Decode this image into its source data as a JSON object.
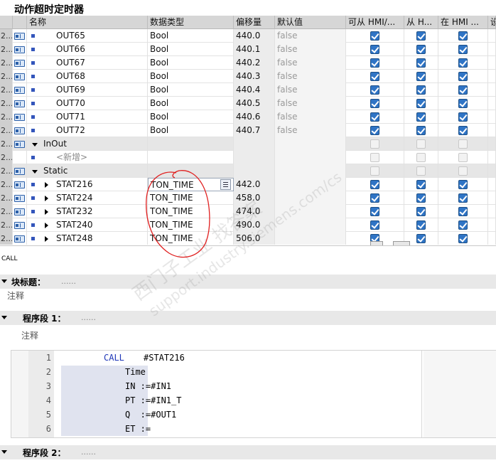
{
  "window": {
    "title": "动作超时定时器"
  },
  "columns": [
    "名称",
    "数据类型",
    "偏移量",
    "默认值",
    "可从 HMI/...",
    "从 H...",
    "在 HMI ...",
    "设"
  ],
  "rows": [
    {
      "num": "2...",
      "icon": "interface-icon",
      "kind": "var",
      "name": "OUT65",
      "type": "Bool",
      "offset": "440.0",
      "default": "false",
      "hmi": [
        true,
        true,
        true
      ]
    },
    {
      "num": "2...",
      "icon": "interface-icon",
      "kind": "var",
      "name": "OUT66",
      "type": "Bool",
      "offset": "440.1",
      "default": "false",
      "hmi": [
        true,
        true,
        true
      ]
    },
    {
      "num": "2...",
      "icon": "interface-icon",
      "kind": "var",
      "name": "OUT67",
      "type": "Bool",
      "offset": "440.2",
      "default": "false",
      "hmi": [
        true,
        true,
        true
      ]
    },
    {
      "num": "2...",
      "icon": "interface-icon",
      "kind": "var",
      "name": "OUT68",
      "type": "Bool",
      "offset": "440.3",
      "default": "false",
      "hmi": [
        true,
        true,
        true
      ]
    },
    {
      "num": "2...",
      "icon": "interface-icon",
      "kind": "var",
      "name": "OUT69",
      "type": "Bool",
      "offset": "440.4",
      "default": "false",
      "hmi": [
        true,
        true,
        true
      ]
    },
    {
      "num": "2...",
      "icon": "interface-icon",
      "kind": "var",
      "name": "OUT70",
      "type": "Bool",
      "offset": "440.5",
      "default": "false",
      "hmi": [
        true,
        true,
        true
      ]
    },
    {
      "num": "2...",
      "icon": "interface-icon",
      "kind": "var",
      "name": "OUT71",
      "type": "Bool",
      "offset": "440.6",
      "default": "false",
      "hmi": [
        true,
        true,
        true
      ]
    },
    {
      "num": "2...",
      "icon": "interface-icon",
      "kind": "var",
      "name": "OUT72",
      "type": "Bool",
      "offset": "440.7",
      "default": "false",
      "hmi": [
        true,
        true,
        true
      ]
    },
    {
      "num": "2...",
      "icon": "interface-icon",
      "kind": "group",
      "name": "InOut",
      "type": "",
      "offset": "",
      "default": "",
      "hmi": [
        false,
        false,
        false
      ]
    },
    {
      "num": "2...",
      "icon": "",
      "kind": "new",
      "name": "<新增>",
      "type": "",
      "offset": "",
      "default": "",
      "hmi": [
        false,
        false,
        false
      ]
    },
    {
      "num": "2...",
      "icon": "interface-icon",
      "kind": "group",
      "name": "Static",
      "type": "",
      "offset": "",
      "default": "",
      "hmi": [
        false,
        false,
        false
      ]
    },
    {
      "num": "2...",
      "icon": "interface-icon",
      "kind": "struct",
      "name": "STAT216",
      "type": "TON_TIME",
      "offset": "442.0",
      "default": "",
      "hmi": [
        true,
        true,
        true
      ]
    },
    {
      "num": "2...",
      "icon": "interface-icon",
      "kind": "struct",
      "name": "STAT224",
      "type": "TON_TIME",
      "offset": "458.0",
      "default": "",
      "hmi": [
        true,
        true,
        true
      ]
    },
    {
      "num": "2...",
      "icon": "interface-icon",
      "kind": "struct",
      "name": "STAT232",
      "type": "TON_TIME",
      "offset": "474.0",
      "default": "",
      "hmi": [
        true,
        true,
        true
      ]
    },
    {
      "num": "2...",
      "icon": "interface-icon",
      "kind": "struct",
      "name": "STAT240",
      "type": "TON_TIME",
      "offset": "490.0",
      "default": "",
      "hmi": [
        true,
        true,
        true
      ]
    },
    {
      "num": "2...",
      "icon": "interface-icon",
      "kind": "struct",
      "name": "STAT248",
      "type": "TON_TIME",
      "offset": "506.0",
      "default": "",
      "hmi": [
        true,
        true,
        true
      ]
    }
  ],
  "call_label": "CALL",
  "block_title": {
    "label": "块标题：",
    "dots": "......",
    "comment": "注释"
  },
  "network1": {
    "label": "程序段 1：",
    "dots": "......",
    "comment": "注释"
  },
  "code": {
    "lines": [
      "1",
      "2",
      "3",
      "4",
      "5",
      "6"
    ],
    "l1_kw": "CALL",
    "l1_rest": "#STAT216",
    "l2": "Time",
    "l3": "IN :=#IN1",
    "l4": "PT :=#IN1_T",
    "l5": "Q  :=#OUT1",
    "l6": "ET :="
  },
  "network2": {
    "label": "程序段 2：",
    "dots": "......"
  },
  "watermark": {
    "line1": "西门子工业 找答案",
    "line2": "support.industry.siemens.com/cs"
  },
  "colors": {
    "checkbox": "#2f74c5",
    "annotation": "#e02020",
    "keyword": "#1f37b8"
  }
}
